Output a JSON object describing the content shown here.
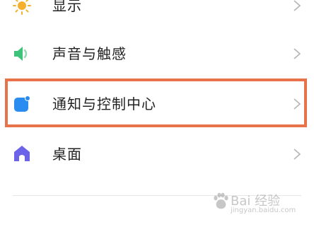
{
  "settings": {
    "items": [
      {
        "label": "显示",
        "icon": "sun-icon",
        "icon_color": "#f5b12c"
      },
      {
        "label": "声音与触感",
        "icon": "speaker-icon",
        "icon_color": "#3ec47a"
      },
      {
        "label": "通知与控制中心",
        "icon": "notification-icon",
        "icon_color": "#2a8cf0"
      },
      {
        "label": "桌面",
        "icon": "home-icon",
        "icon_color": "#6b63e8"
      }
    ]
  },
  "highlight": {
    "color": "#e8734a"
  },
  "watermark": {
    "text": "Bai 经验",
    "subtext": "jingyan.baidu.com"
  }
}
